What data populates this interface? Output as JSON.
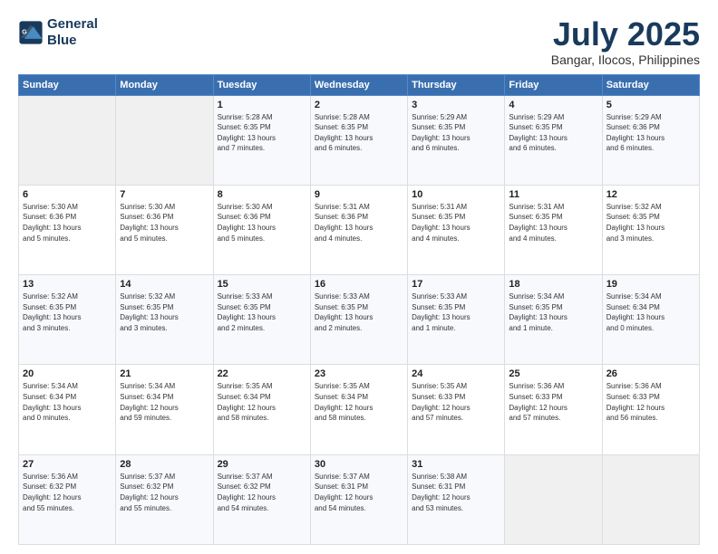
{
  "logo": {
    "line1": "General",
    "line2": "Blue"
  },
  "title": "July 2025",
  "location": "Bangar, Ilocos, Philippines",
  "days_of_week": [
    "Sunday",
    "Monday",
    "Tuesday",
    "Wednesday",
    "Thursday",
    "Friday",
    "Saturday"
  ],
  "weeks": [
    [
      {
        "num": "",
        "detail": ""
      },
      {
        "num": "",
        "detail": ""
      },
      {
        "num": "1",
        "detail": "Sunrise: 5:28 AM\nSunset: 6:35 PM\nDaylight: 13 hours\nand 7 minutes."
      },
      {
        "num": "2",
        "detail": "Sunrise: 5:28 AM\nSunset: 6:35 PM\nDaylight: 13 hours\nand 6 minutes."
      },
      {
        "num": "3",
        "detail": "Sunrise: 5:29 AM\nSunset: 6:35 PM\nDaylight: 13 hours\nand 6 minutes."
      },
      {
        "num": "4",
        "detail": "Sunrise: 5:29 AM\nSunset: 6:35 PM\nDaylight: 13 hours\nand 6 minutes."
      },
      {
        "num": "5",
        "detail": "Sunrise: 5:29 AM\nSunset: 6:36 PM\nDaylight: 13 hours\nand 6 minutes."
      }
    ],
    [
      {
        "num": "6",
        "detail": "Sunrise: 5:30 AM\nSunset: 6:36 PM\nDaylight: 13 hours\nand 5 minutes."
      },
      {
        "num": "7",
        "detail": "Sunrise: 5:30 AM\nSunset: 6:36 PM\nDaylight: 13 hours\nand 5 minutes."
      },
      {
        "num": "8",
        "detail": "Sunrise: 5:30 AM\nSunset: 6:36 PM\nDaylight: 13 hours\nand 5 minutes."
      },
      {
        "num": "9",
        "detail": "Sunrise: 5:31 AM\nSunset: 6:36 PM\nDaylight: 13 hours\nand 4 minutes."
      },
      {
        "num": "10",
        "detail": "Sunrise: 5:31 AM\nSunset: 6:35 PM\nDaylight: 13 hours\nand 4 minutes."
      },
      {
        "num": "11",
        "detail": "Sunrise: 5:31 AM\nSunset: 6:35 PM\nDaylight: 13 hours\nand 4 minutes."
      },
      {
        "num": "12",
        "detail": "Sunrise: 5:32 AM\nSunset: 6:35 PM\nDaylight: 13 hours\nand 3 minutes."
      }
    ],
    [
      {
        "num": "13",
        "detail": "Sunrise: 5:32 AM\nSunset: 6:35 PM\nDaylight: 13 hours\nand 3 minutes."
      },
      {
        "num": "14",
        "detail": "Sunrise: 5:32 AM\nSunset: 6:35 PM\nDaylight: 13 hours\nand 3 minutes."
      },
      {
        "num": "15",
        "detail": "Sunrise: 5:33 AM\nSunset: 6:35 PM\nDaylight: 13 hours\nand 2 minutes."
      },
      {
        "num": "16",
        "detail": "Sunrise: 5:33 AM\nSunset: 6:35 PM\nDaylight: 13 hours\nand 2 minutes."
      },
      {
        "num": "17",
        "detail": "Sunrise: 5:33 AM\nSunset: 6:35 PM\nDaylight: 13 hours\nand 1 minute."
      },
      {
        "num": "18",
        "detail": "Sunrise: 5:34 AM\nSunset: 6:35 PM\nDaylight: 13 hours\nand 1 minute."
      },
      {
        "num": "19",
        "detail": "Sunrise: 5:34 AM\nSunset: 6:34 PM\nDaylight: 13 hours\nand 0 minutes."
      }
    ],
    [
      {
        "num": "20",
        "detail": "Sunrise: 5:34 AM\nSunset: 6:34 PM\nDaylight: 13 hours\nand 0 minutes."
      },
      {
        "num": "21",
        "detail": "Sunrise: 5:34 AM\nSunset: 6:34 PM\nDaylight: 12 hours\nand 59 minutes."
      },
      {
        "num": "22",
        "detail": "Sunrise: 5:35 AM\nSunset: 6:34 PM\nDaylight: 12 hours\nand 58 minutes."
      },
      {
        "num": "23",
        "detail": "Sunrise: 5:35 AM\nSunset: 6:34 PM\nDaylight: 12 hours\nand 58 minutes."
      },
      {
        "num": "24",
        "detail": "Sunrise: 5:35 AM\nSunset: 6:33 PM\nDaylight: 12 hours\nand 57 minutes."
      },
      {
        "num": "25",
        "detail": "Sunrise: 5:36 AM\nSunset: 6:33 PM\nDaylight: 12 hours\nand 57 minutes."
      },
      {
        "num": "26",
        "detail": "Sunrise: 5:36 AM\nSunset: 6:33 PM\nDaylight: 12 hours\nand 56 minutes."
      }
    ],
    [
      {
        "num": "27",
        "detail": "Sunrise: 5:36 AM\nSunset: 6:32 PM\nDaylight: 12 hours\nand 55 minutes."
      },
      {
        "num": "28",
        "detail": "Sunrise: 5:37 AM\nSunset: 6:32 PM\nDaylight: 12 hours\nand 55 minutes."
      },
      {
        "num": "29",
        "detail": "Sunrise: 5:37 AM\nSunset: 6:32 PM\nDaylight: 12 hours\nand 54 minutes."
      },
      {
        "num": "30",
        "detail": "Sunrise: 5:37 AM\nSunset: 6:31 PM\nDaylight: 12 hours\nand 54 minutes."
      },
      {
        "num": "31",
        "detail": "Sunrise: 5:38 AM\nSunset: 6:31 PM\nDaylight: 12 hours\nand 53 minutes."
      },
      {
        "num": "",
        "detail": ""
      },
      {
        "num": "",
        "detail": ""
      }
    ]
  ]
}
